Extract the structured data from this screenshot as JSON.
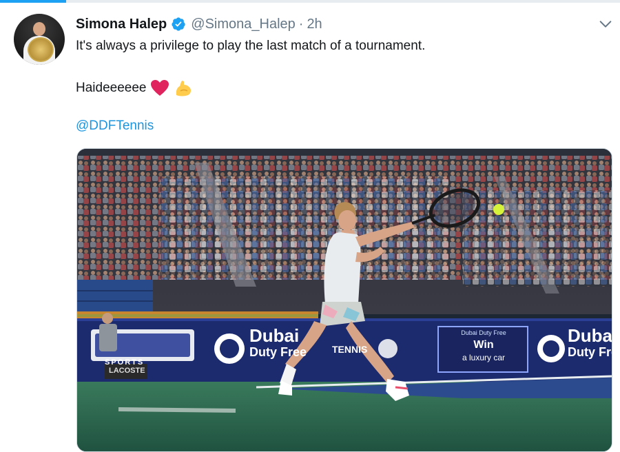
{
  "tweet": {
    "author_name": "Simona Halep",
    "handle": "@Simona_Halep",
    "separator": "·",
    "time": "2h",
    "text_line1": "It's always a privilege to play the last match of a tournament.",
    "text_line2": "Haideeeeee",
    "mention": "@DDFTennis"
  },
  "media": {
    "ad_board": {
      "brand_left": "Dubai",
      "brand_left_sub": "Duty Free",
      "tennis": "TENNIS",
      "promo_title": "Dubai Duty Free",
      "promo_main": "Win",
      "promo_sub": "a luxury car",
      "brand_right": "Dubai",
      "brand_right_sub": "Duty Free",
      "sponsor_left": "SPORTS",
      "sponsor_lacoste": "LACOSTE"
    }
  },
  "colors": {
    "accent": "#1da1f2",
    "link": "#1b95e0",
    "verified": "#1da1f2",
    "heart": "#e0245e",
    "muscle": "#ffcc4d",
    "court": "#2f6e52",
    "ad_board": "#1c2a6e"
  },
  "icons": {
    "verified": "verified-badge-icon",
    "caret": "chevron-down-icon",
    "heart": "red-heart-emoji",
    "muscle": "flexed-biceps-emoji"
  }
}
